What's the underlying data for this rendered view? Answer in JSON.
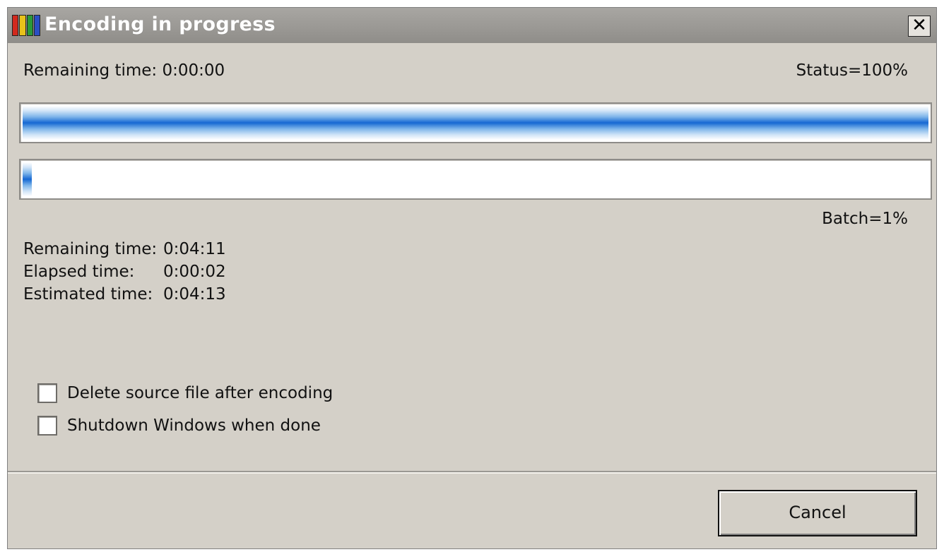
{
  "window": {
    "title": "Encoding in progress",
    "close_glyph": "✕"
  },
  "current_file": {
    "remaining_label": "Remaining time:",
    "remaining_value": "0:00:00",
    "status_text": "Status=100%",
    "progress": 1.0
  },
  "batch": {
    "status_text": "Batch=1%",
    "progress": 0.01,
    "stats": [
      {
        "label": "Remaining time:",
        "value": "0:04:11"
      },
      {
        "label": "Elapsed time:",
        "value": "0:00:02"
      },
      {
        "label": "Estimated time:",
        "value": "0:04:13"
      }
    ]
  },
  "options": [
    {
      "label": "Delete source file after encoding",
      "checked": false
    },
    {
      "label": "Shutdown Windows when done",
      "checked": false
    }
  ],
  "buttons": {
    "cancel_label": "Cancel"
  },
  "icons": {
    "app": "app-film-strip-icon",
    "close": "close-icon"
  }
}
